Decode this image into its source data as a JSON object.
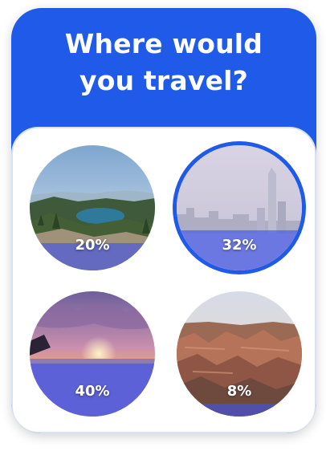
{
  "poll": {
    "title": "Where would\nyou travel?",
    "accent_color": "#1f5ae8",
    "options": [
      {
        "scene": "lake-mountain-forest",
        "percent_label": "20%",
        "percent": 20,
        "selected": false
      },
      {
        "scene": "city-skyline-harbor",
        "percent_label": "32%",
        "percent": 32,
        "selected": true
      },
      {
        "scene": "beach-sunset",
        "percent_label": "40%",
        "percent": 40,
        "selected": false
      },
      {
        "scene": "grand-canyon",
        "percent_label": "8%",
        "percent": 8,
        "selected": false
      }
    ]
  }
}
